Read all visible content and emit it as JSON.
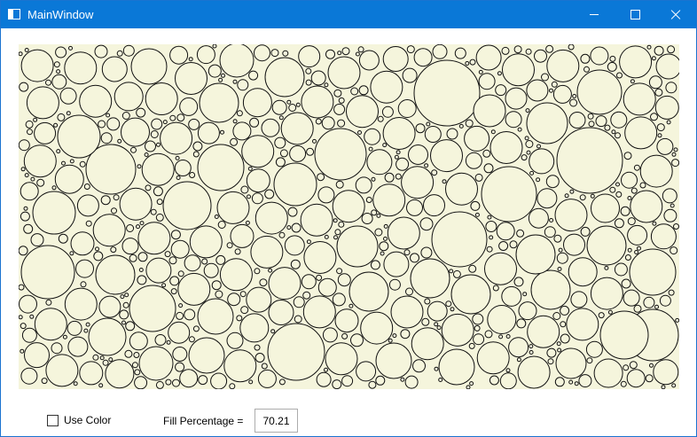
{
  "window": {
    "title": "MainWindow"
  },
  "title_buttons": {
    "minimize": "minimize",
    "maximize": "maximize",
    "close": "close"
  },
  "canvas": {
    "background": "#f5f5dc",
    "circle_fill": "#f5f5dc",
    "circle_stroke": "#111111"
  },
  "controls": {
    "use_color_label": "Use Color",
    "use_color_checked": false,
    "fill_percentage_label": "Fill Percentage =",
    "fill_percentage_value": "70.21"
  }
}
